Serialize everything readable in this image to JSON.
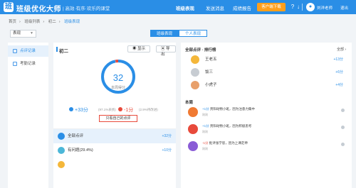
{
  "header": {
    "logo": "班",
    "title": "班级优化大师",
    "slogan": "| 高效·有序·欢乐的课堂",
    "nav": [
      "班级表现",
      "发送消息",
      "成绩报告"
    ],
    "download": "客户端下载",
    "user": "刘洋老师",
    "logout": "退出"
  },
  "breadcrumb": [
    "首页",
    "班级列表",
    "初二",
    "班级表现"
  ],
  "class_select": "表现",
  "tabs": [
    "班级表现",
    "个人表现"
  ],
  "sidebar": [
    {
      "label": "点评记录",
      "active": true
    },
    {
      "label": "考勤记录",
      "active": false
    }
  ],
  "left": {
    "grade": "初二",
    "btn_display": "显示",
    "btn_export": "导出",
    "score": "32",
    "score_label": "本周得分",
    "positive": "+33分",
    "positive_sub": "(97.1%表扬)",
    "negative": "-1分",
    "negative_sub": "(2.9%待改进)",
    "only_mine": "只看自己的点评",
    "rows": [
      {
        "label": "全部点评",
        "points": "+32分"
      },
      {
        "label": "有问题(29.4%)",
        "points": "+10分"
      },
      {
        "label": "",
        "points": ""
      }
    ]
  },
  "right": {
    "rank_title": "全部点评 · 排行榜",
    "rank_all": "全部 ›",
    "rank": [
      {
        "name": "王老五",
        "points": "+13分",
        "color": "#f4b73a"
      },
      {
        "name": "饭三",
        "points": "+6分",
        "color": "#c7ccd2"
      },
      {
        "name": "小虎子",
        "points": "+4分",
        "color": "#e8a06b"
      }
    ],
    "feed_title": "本周",
    "feed": [
      {
        "delta": "+1分",
        "text": "贵阳动物小班，因为注意力集中",
        "time": "刚刚",
        "color": "#f07a32",
        "neg": false
      },
      {
        "delta": "+1分",
        "text": "贵阳动物小班，因为积极思考",
        "time": "刚刚",
        "color": "#e84a3b",
        "neg": false
      },
      {
        "delta": "-1分",
        "text": "批评张学思，因为上课走神",
        "time": "刚刚",
        "color": "#8a5cd6",
        "neg": true
      }
    ]
  }
}
